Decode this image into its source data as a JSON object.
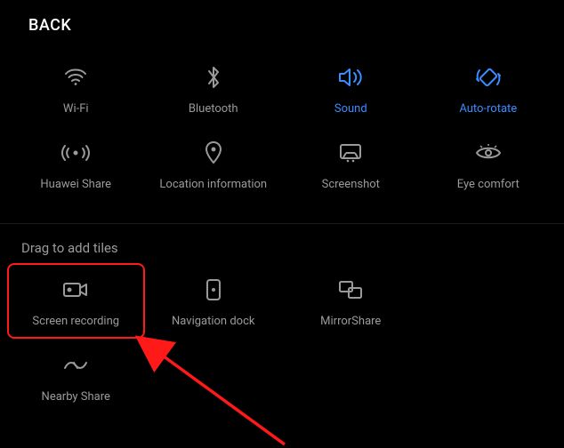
{
  "back_label": "BACK",
  "colors": {
    "inactive": "#9a9a9a",
    "active": "#3b8cff",
    "highlight": "#ff1a1a"
  },
  "active_tiles": [
    {
      "id": "wifi",
      "label": "Wi-Fi",
      "active": false
    },
    {
      "id": "bluetooth",
      "label": "Bluetooth",
      "active": false
    },
    {
      "id": "sound",
      "label": "Sound",
      "active": true
    },
    {
      "id": "autorotate",
      "label": "Auto-rotate",
      "active": true
    },
    {
      "id": "huaweishare",
      "label": "Huawei Share",
      "active": false
    },
    {
      "id": "location",
      "label": "Location information",
      "active": false
    },
    {
      "id": "screenshot",
      "label": "Screenshot",
      "active": false
    },
    {
      "id": "eyecomfort",
      "label": "Eye comfort",
      "active": false
    }
  ],
  "drag_section_label": "Drag to add tiles",
  "inactive_tiles": [
    {
      "id": "screenrecording",
      "label": "Screen recording",
      "highlighted": true
    },
    {
      "id": "navigationdock",
      "label": "Navigation dock"
    },
    {
      "id": "mirrorshare",
      "label": "MirrorShare"
    },
    {
      "id": "nearbyshare",
      "label": "Nearby Share"
    }
  ]
}
